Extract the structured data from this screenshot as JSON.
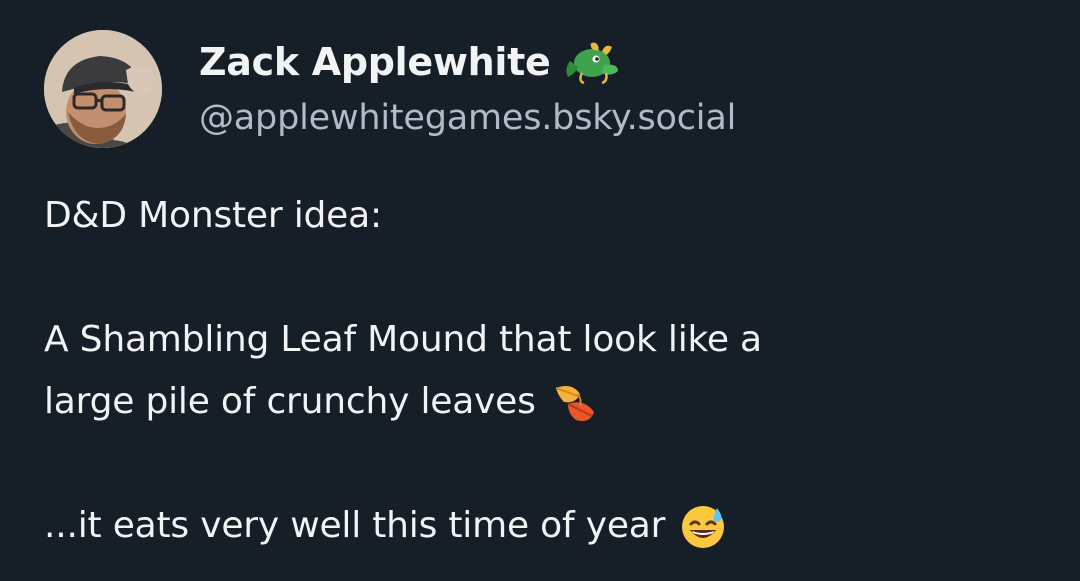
{
  "author": {
    "display_name": "Zack Applewhite",
    "handle": "@applewhitegames.bsky.social",
    "name_emoji": "dragon-face-icon"
  },
  "post": {
    "line_1": "D&D Monster idea:",
    "line_2": "A Shambling Leaf Mound that look like a",
    "line_3": "large pile of crunchy leaves",
    "line_3_emoji": "fallen-leaf-icon",
    "line_4": "...it eats very well this time of year",
    "line_4_emoji": "grinning-sweat-face-icon"
  },
  "colors": {
    "background": "#161e27",
    "text": "#f1f3f5",
    "handle": "#aebbc9"
  }
}
